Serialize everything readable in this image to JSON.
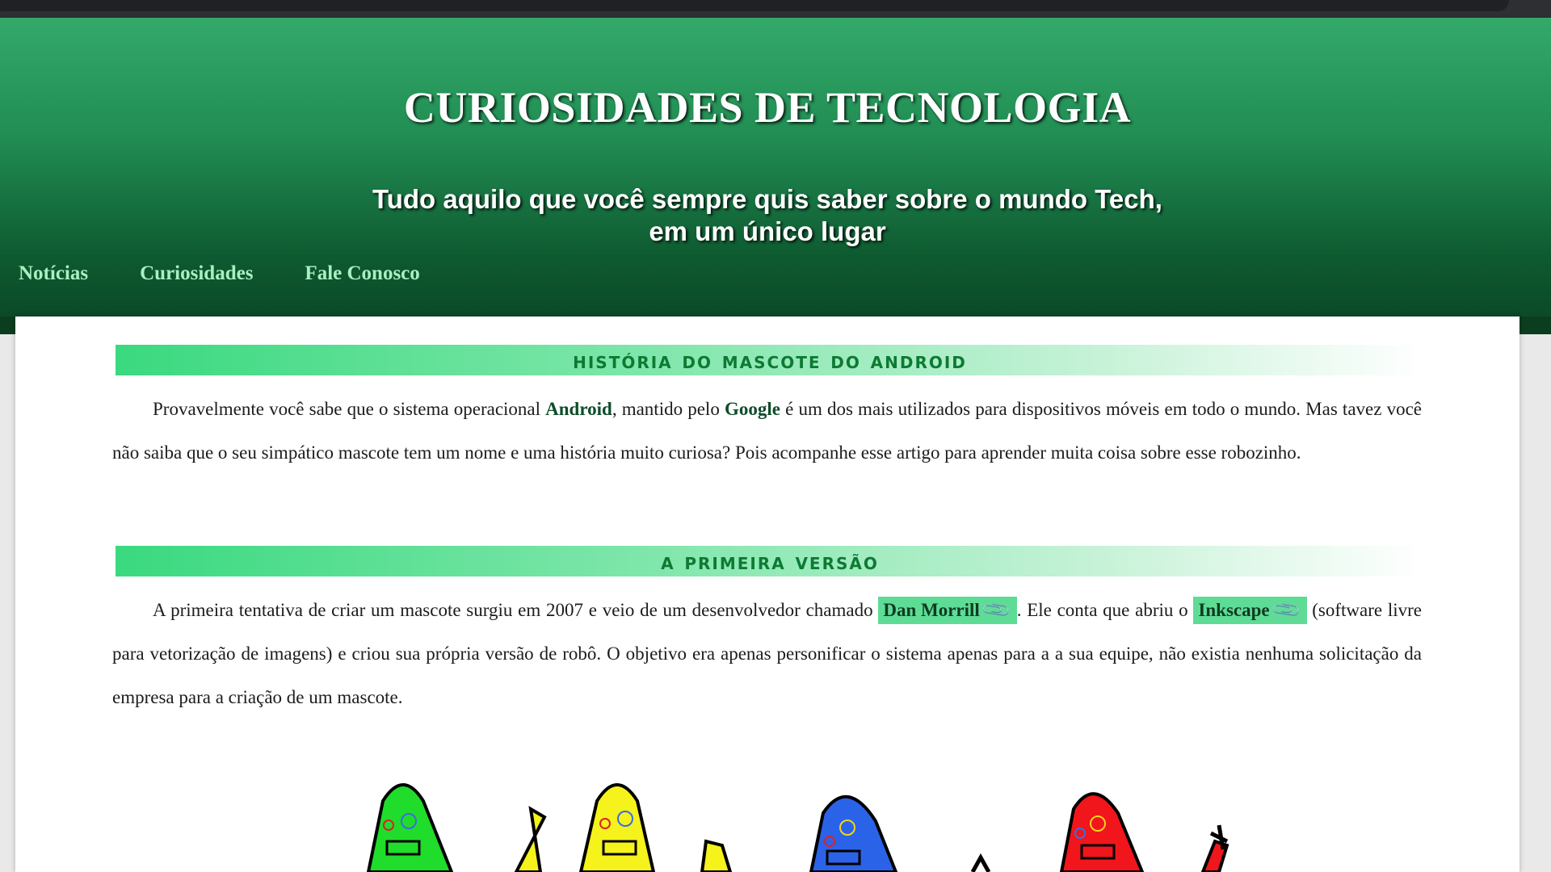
{
  "header": {
    "title": "CURIOSIDADES DE TECNOLOGIA",
    "subtitle_line1": "Tudo aquilo que você sempre quis saber sobre o mundo Tech,",
    "subtitle_line2": "em um único lugar"
  },
  "nav": {
    "items": [
      {
        "label": "Notícias"
      },
      {
        "label": "Curiosidades"
      },
      {
        "label": "Fale Conosco"
      }
    ]
  },
  "sections": [
    {
      "heading": "História do mascote do Android",
      "paragraph": {
        "p1": "Provavelmente você sabe que o sistema operacional ",
        "b1": "Android",
        "p2": ", mantido pelo ",
        "b2": "Google",
        "p3": " é um dos mais utilizados para dispositivos móveis em todo o mundo. Mas tavez você não saiba que o seu simpático mascote tem um nome e uma história muito curiosa? Pois acompanhe esse artigo para aprender muita coisa sobre esse robozinho."
      }
    },
    {
      "heading": "A primeira versão",
      "paragraph": {
        "p1": "A primeira tentativa de criar um mascote surgiu em 2007 e veio de um desenvolvedor chamado ",
        "link1": "Dan Morrill",
        "p2": ". Ele conta que abriu o ",
        "link2": "Inkscape",
        "p3": " (software livre para vetorização de imagens) e criou sua própria versão de robô. O objetivo era apenas personificar o sistema apenas para a a sua equipe, não existia nenhuma solicitação da empresa para a criação de um mascote."
      }
    }
  ],
  "icons": {
    "link": "paperclip-icon"
  },
  "colors": {
    "header_top": "#33a96a",
    "header_bottom": "#0b4a28",
    "nav_link": "#a8f0c0",
    "heading_text": "#0d7a33",
    "chip_bg": "#5edc96",
    "robot_green": "#1fdd2a",
    "robot_yellow": "#f5f21c",
    "robot_blue": "#2b63e8",
    "robot_red": "#f0161b"
  }
}
